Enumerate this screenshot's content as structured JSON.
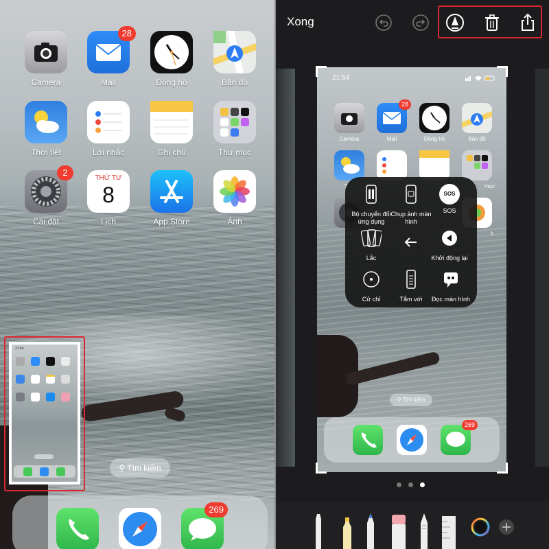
{
  "home": {
    "apps": [
      {
        "label": "Camera",
        "icon": "camera-icon"
      },
      {
        "label": "Mail",
        "icon": "mail-icon",
        "badge": "28"
      },
      {
        "label": "Đồng hồ",
        "icon": "clock-icon"
      },
      {
        "label": "Bản đồ",
        "icon": "maps-icon"
      },
      {
        "label": "Thời tiết",
        "icon": "weather-icon"
      },
      {
        "label": "Lời nhắc",
        "icon": "reminders-icon"
      },
      {
        "label": "Ghi chú",
        "icon": "notes-icon"
      },
      {
        "label": "Thư mục",
        "icon": "folder-icon"
      },
      {
        "label": "Cài đặt",
        "icon": "settings-icon",
        "badge": "2"
      },
      {
        "label": "Lịch",
        "icon": "calendar-icon",
        "calendar_day": "THỨ TƯ",
        "calendar_date": "8"
      },
      {
        "label": "App Store",
        "icon": "app-store-icon"
      },
      {
        "label": "Ảnh",
        "icon": "photos-icon"
      }
    ],
    "search_label": "Tìm kiếm",
    "dock": {
      "messages_badge": "269"
    }
  },
  "editor": {
    "done_label": "Xong",
    "screenshot": {
      "time": "21:54",
      "apps": [
        {
          "label": "Camera"
        },
        {
          "label": "Mail",
          "badge": "28"
        },
        {
          "label": "Đồng hồ"
        },
        {
          "label": "Bản đồ"
        }
      ],
      "row2_partial_label": "Thờ",
      "row2_folder_label": "mục",
      "row3_partial_label": "Cả",
      "row3_photos_label": "h",
      "search_label": "Tìm kiếm",
      "messages_badge": "269"
    },
    "assistive_menu": [
      {
        "label": "Bộ chuyển đổi ứng dụng",
        "icon": "app-switcher-icon"
      },
      {
        "label": "Chụp ảnh màn hình",
        "icon": "screenshot-icon"
      },
      {
        "label": "SOS",
        "icon": "sos-icon",
        "glyph": "SOS"
      },
      {
        "label": "Lắc",
        "icon": "shake-icon"
      },
      {
        "label": "",
        "icon": "back-arrow-icon"
      },
      {
        "label": "Khởi động lại",
        "icon": "restart-icon"
      },
      {
        "label": "Cử chỉ",
        "icon": "gesture-icon"
      },
      {
        "label": "Tắm với",
        "icon": "reachability-icon"
      },
      {
        "label": "Đọc màn hình",
        "icon": "speak-screen-icon"
      }
    ]
  },
  "colors": {
    "badge": "#ef3b30",
    "highlight": "#d9282f",
    "accent_blue": "#1a73e8"
  }
}
